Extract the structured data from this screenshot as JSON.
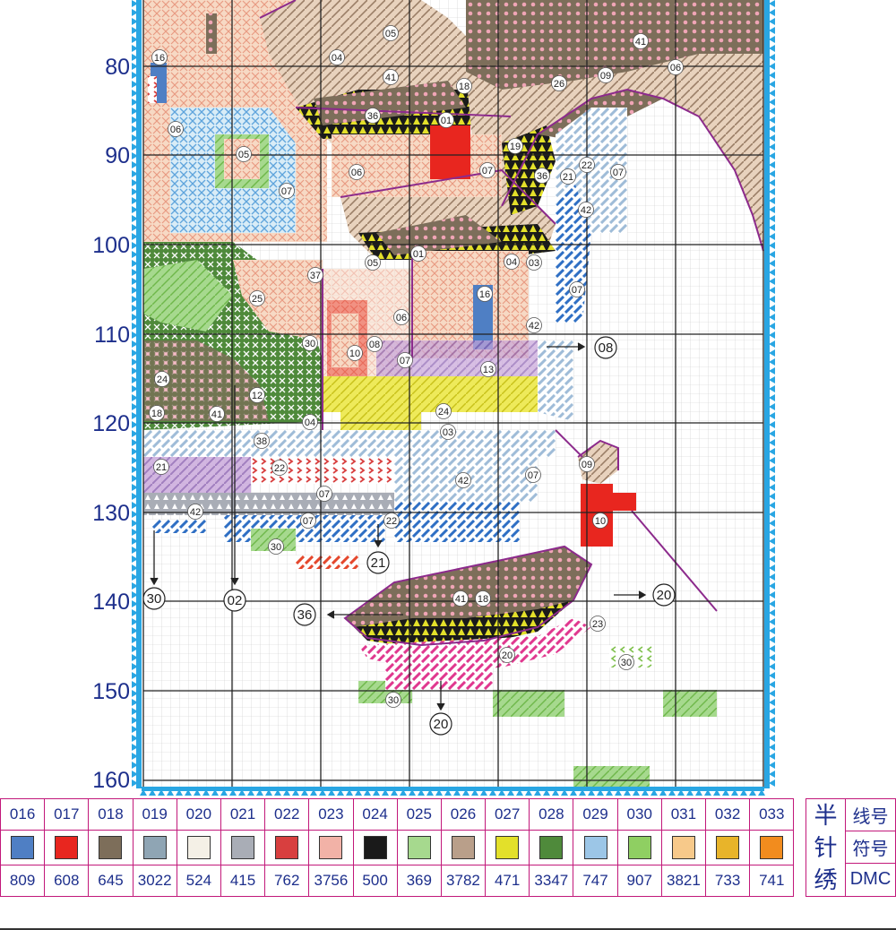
{
  "y_axis_labels": [
    "80",
    "90",
    "100",
    "110",
    "120",
    "130",
    "140",
    "150",
    "160"
  ],
  "callouts": [
    {
      "text": "08"
    },
    {
      "text": "30"
    },
    {
      "text": "02"
    },
    {
      "text": "21"
    },
    {
      "text": "36"
    },
    {
      "text": "20"
    },
    {
      "text": "20"
    }
  ],
  "chart_symbol_labels": [
    "16",
    "06",
    "05",
    "07",
    "04",
    "41",
    "18",
    "36",
    "01",
    "05",
    "41",
    "09",
    "06",
    "26",
    "19",
    "07",
    "36",
    "21",
    "22",
    "07",
    "42",
    "06",
    "01",
    "05",
    "04",
    "03",
    "16",
    "07",
    "37",
    "25",
    "06",
    "42",
    "08",
    "10",
    "30",
    "07",
    "13",
    "24",
    "12",
    "18",
    "41",
    "04",
    "24",
    "03",
    "38",
    "21",
    "22",
    "42",
    "07",
    "07",
    "22",
    "42",
    "07",
    "30",
    "09",
    "10",
    "41",
    "18",
    "23",
    "30",
    "20",
    "30"
  ],
  "legend": {
    "codes": [
      "016",
      "017",
      "018",
      "019",
      "020",
      "021",
      "022",
      "023",
      "024",
      "025",
      "026",
      "027",
      "028",
      "029",
      "030",
      "031",
      "032",
      "033"
    ],
    "swatches": [
      {
        "icon": "solid-square",
        "color": "#4f7fc4"
      },
      {
        "icon": "white-dots-on-red",
        "color": "#e8261f"
      },
      {
        "icon": "pink-dots-on-brown",
        "color": "#7d6e5a"
      },
      {
        "icon": "blue-triangles-on-gray",
        "color": "#8fa5b4"
      },
      {
        "icon": "white-grid",
        "color": "#f4f0e6"
      },
      {
        "icon": "white-triangles-on-gray",
        "color": "#a9adb6"
      },
      {
        "icon": "red-chevrons",
        "color": "#d83f3f"
      },
      {
        "icon": "pink-crosses",
        "color": "#f2b2a7"
      },
      {
        "icon": "yellow-triangles-on-black",
        "color": "#1a1a1a"
      },
      {
        "icon": "green-diagonal",
        "color": "#a6d98e"
      },
      {
        "icon": "brown-diagonal",
        "color": "#b99f8a"
      },
      {
        "icon": "yellow-diagonal",
        "color": "#e3e02a"
      },
      {
        "icon": "white-crosses-on-green",
        "color": "#4f8a3b"
      },
      {
        "icon": "red-l-marks-on-blue",
        "color": "#9cc6e7"
      },
      {
        "icon": "green-chevrons",
        "color": "#8fcf62"
      },
      {
        "icon": "orange-crosses",
        "color": "#f7c98a"
      },
      {
        "icon": "orange-dots-on-yellow",
        "color": "#e8b42a"
      },
      {
        "icon": "orange-triangles",
        "color": "#f28c1e"
      }
    ],
    "dmc": [
      "809",
      "608",
      "645",
      "3022",
      "524",
      "415",
      "762",
      "3756",
      "500",
      "369",
      "3782",
      "471",
      "3347",
      "747",
      "907",
      "3821",
      "733",
      "741"
    ]
  },
  "half_stitch": {
    "title_chars": [
      "半",
      "针",
      "绣"
    ],
    "row_labels": [
      "线号",
      "符号",
      "DMC"
    ]
  },
  "colors": {
    "border_ticks": "#29a6e3",
    "legend_border": "#c2187a",
    "label_blue": "#1d2f8c",
    "backstitch_purple": "#8c2a8c",
    "grid_line": "#c9c9c9",
    "grid_major": "#222222"
  }
}
